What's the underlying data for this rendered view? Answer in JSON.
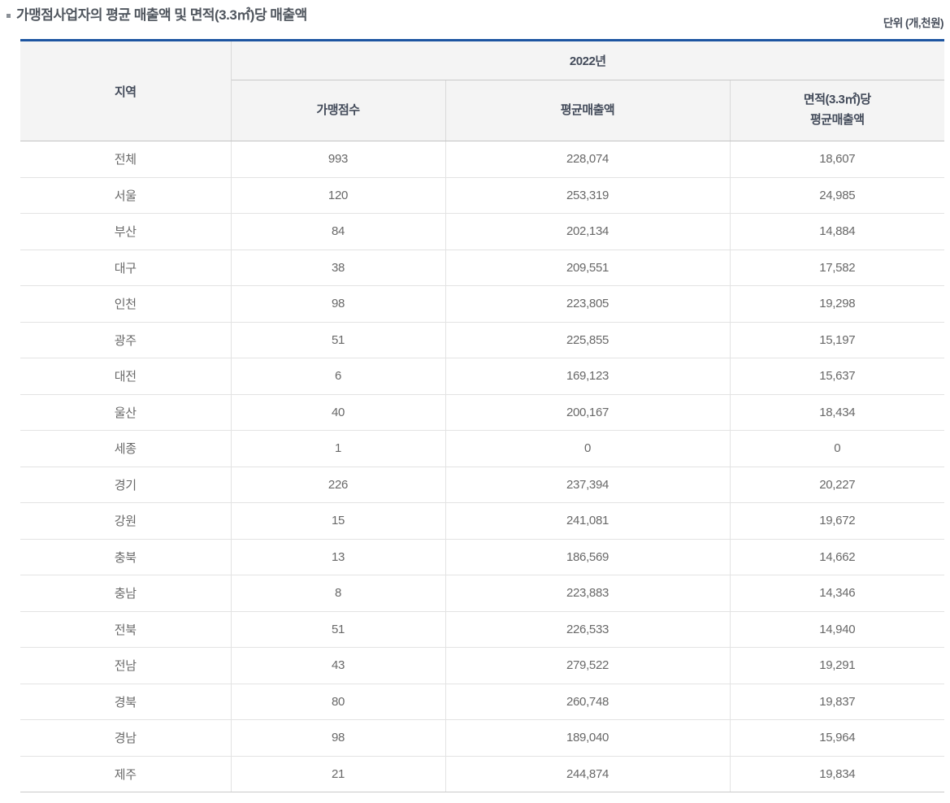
{
  "page": {
    "title": "가맹점사업자의 평균 매출액 및 면적(3.3㎡)당 매출액",
    "unit_label": "단위 (개,천원)"
  },
  "table": {
    "region_header": "지역",
    "year_header": "2022년",
    "col_stores": "가맹점수",
    "col_avg_sales": "평균매출액",
    "col_area_sales_line1": "면적(3.3㎡)당",
    "col_area_sales_line2": "평균매출액",
    "rows": [
      {
        "region": "전체",
        "stores": "993",
        "avg_sales": "228,074",
        "area_sales": "18,607"
      },
      {
        "region": "서울",
        "stores": "120",
        "avg_sales": "253,319",
        "area_sales": "24,985"
      },
      {
        "region": "부산",
        "stores": "84",
        "avg_sales": "202,134",
        "area_sales": "14,884"
      },
      {
        "region": "대구",
        "stores": "38",
        "avg_sales": "209,551",
        "area_sales": "17,582"
      },
      {
        "region": "인천",
        "stores": "98",
        "avg_sales": "223,805",
        "area_sales": "19,298"
      },
      {
        "region": "광주",
        "stores": "51",
        "avg_sales": "225,855",
        "area_sales": "15,197"
      },
      {
        "region": "대전",
        "stores": "6",
        "avg_sales": "169,123",
        "area_sales": "15,637"
      },
      {
        "region": "울산",
        "stores": "40",
        "avg_sales": "200,167",
        "area_sales": "18,434"
      },
      {
        "region": "세종",
        "stores": "1",
        "avg_sales": "0",
        "area_sales": "0"
      },
      {
        "region": "경기",
        "stores": "226",
        "avg_sales": "237,394",
        "area_sales": "20,227"
      },
      {
        "region": "강원",
        "stores": "15",
        "avg_sales": "241,081",
        "area_sales": "19,672"
      },
      {
        "region": "충북",
        "stores": "13",
        "avg_sales": "186,569",
        "area_sales": "14,662"
      },
      {
        "region": "충남",
        "stores": "8",
        "avg_sales": "223,883",
        "area_sales": "14,346"
      },
      {
        "region": "전북",
        "stores": "51",
        "avg_sales": "226,533",
        "area_sales": "14,940"
      },
      {
        "region": "전남",
        "stores": "43",
        "avg_sales": "279,522",
        "area_sales": "19,291"
      },
      {
        "region": "경북",
        "stores": "80",
        "avg_sales": "260,748",
        "area_sales": "19,837"
      },
      {
        "region": "경남",
        "stores": "98",
        "avg_sales": "189,040",
        "area_sales": "15,964"
      },
      {
        "region": "제주",
        "stores": "21",
        "avg_sales": "244,874",
        "area_sales": "19,834"
      }
    ]
  },
  "colors": {
    "accent_top_border": "#1d55a1",
    "header_bg": "#f4f4f4",
    "header_text": "#434b5a",
    "body_text": "#686868",
    "row_border": "#e3e3e3",
    "header_divider": "#d9d9d9",
    "bottom_border": "#c9c9c9"
  },
  "chart_data": {
    "type": "table",
    "title": "가맹점사업자의 평균 매출액 및 면적(3.3㎡)당 매출액",
    "unit": "단위 (개,천원)",
    "year_group": "2022년",
    "columns": [
      "지역",
      "가맹점수",
      "평균매출액",
      "면적(3.3㎡)당 평균매출액"
    ],
    "rows": [
      [
        "전체",
        993,
        228074,
        18607
      ],
      [
        "서울",
        120,
        253319,
        24985
      ],
      [
        "부산",
        84,
        202134,
        14884
      ],
      [
        "대구",
        38,
        209551,
        17582
      ],
      [
        "인천",
        98,
        223805,
        19298
      ],
      [
        "광주",
        51,
        225855,
        15197
      ],
      [
        "대전",
        6,
        169123,
        15637
      ],
      [
        "울산",
        40,
        200167,
        18434
      ],
      [
        "세종",
        1,
        0,
        0
      ],
      [
        "경기",
        226,
        237394,
        20227
      ],
      [
        "강원",
        15,
        241081,
        19672
      ],
      [
        "충북",
        13,
        186569,
        14662
      ],
      [
        "충남",
        8,
        223883,
        14346
      ],
      [
        "전북",
        51,
        226533,
        14940
      ],
      [
        "전남",
        43,
        279522,
        19291
      ],
      [
        "경북",
        80,
        260748,
        19837
      ],
      [
        "경남",
        98,
        189040,
        15964
      ],
      [
        "제주",
        21,
        244874,
        19834
      ]
    ]
  }
}
